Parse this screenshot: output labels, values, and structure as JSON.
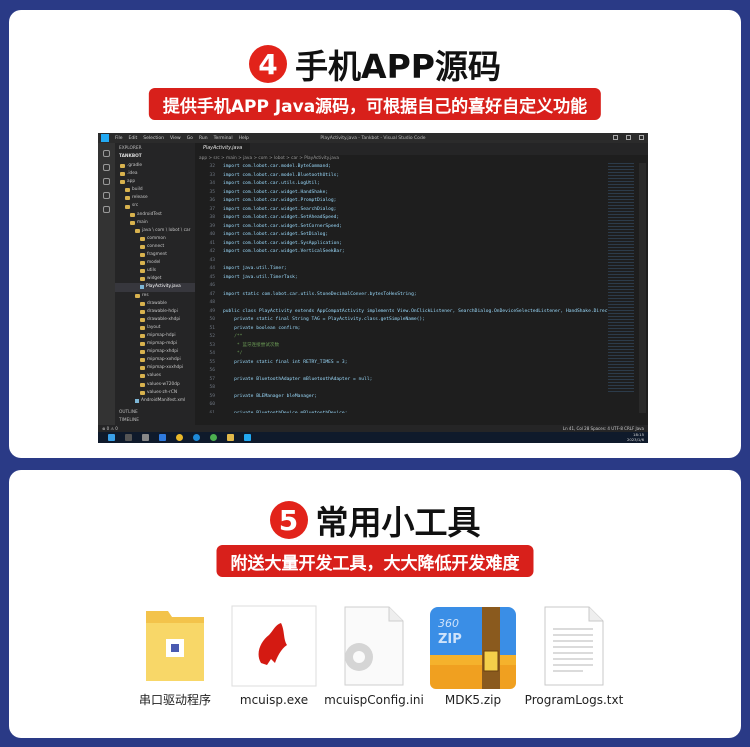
{
  "section4": {
    "number": "4",
    "title": "手机APP源码",
    "subtitle": "提供手机APP Java源码，可根据自己的喜好自定义功能"
  },
  "vscode": {
    "menu": [
      "File",
      "Edit",
      "Selection",
      "View",
      "Go",
      "Run",
      "Terminal",
      "Help"
    ],
    "window_title": "PlayActivity.java - Tankbot - Visual Studio Code",
    "explorer_header": "EXPLORER",
    "explorer_root": "TANKBOT",
    "tree": [
      {
        "label": ".gradle",
        "type": "folder",
        "indent": 1
      },
      {
        "label": ".idea",
        "type": "folder",
        "indent": 1
      },
      {
        "label": "app",
        "type": "folder",
        "indent": 1
      },
      {
        "label": "build",
        "type": "folder",
        "indent": 2
      },
      {
        "label": "release",
        "type": "folder",
        "indent": 2
      },
      {
        "label": "src",
        "type": "folder",
        "indent": 2
      },
      {
        "label": "androidTest",
        "type": "folder",
        "indent": 3
      },
      {
        "label": "main",
        "type": "folder",
        "indent": 3
      },
      {
        "label": "java \\ com \\ lobot \\ car",
        "type": "folder",
        "indent": 4
      },
      {
        "label": "common",
        "type": "folder",
        "indent": 5
      },
      {
        "label": "connect",
        "type": "folder",
        "indent": 5
      },
      {
        "label": "fragment",
        "type": "folder",
        "indent": 5
      },
      {
        "label": "model",
        "type": "folder",
        "indent": 5
      },
      {
        "label": "utils",
        "type": "folder",
        "indent": 5
      },
      {
        "label": "widget",
        "type": "folder",
        "indent": 5
      },
      {
        "label": "PlayActivity.java",
        "type": "file",
        "indent": 5,
        "selected": true
      },
      {
        "label": "res",
        "type": "folder",
        "indent": 4
      },
      {
        "label": "drawable",
        "type": "folder",
        "indent": 5
      },
      {
        "label": "drawable-hdpi",
        "type": "folder",
        "indent": 5
      },
      {
        "label": "drawable-xhdpi",
        "type": "folder",
        "indent": 5
      },
      {
        "label": "layout",
        "type": "folder",
        "indent": 5
      },
      {
        "label": "mipmap-hdpi",
        "type": "folder",
        "indent": 5
      },
      {
        "label": "mipmap-mdpi",
        "type": "folder",
        "indent": 5
      },
      {
        "label": "mipmap-xhdpi",
        "type": "folder",
        "indent": 5
      },
      {
        "label": "mipmap-xxhdpi",
        "type": "folder",
        "indent": 5
      },
      {
        "label": "mipmap-xxxhdpi",
        "type": "folder",
        "indent": 5
      },
      {
        "label": "values",
        "type": "folder",
        "indent": 5
      },
      {
        "label": "values-w720dp",
        "type": "folder",
        "indent": 5
      },
      {
        "label": "values-zh-rCN",
        "type": "folder",
        "indent": 5
      },
      {
        "label": "AndroidManifest.xml",
        "type": "file",
        "indent": 4
      }
    ],
    "outline": "OUTLINE",
    "timeline": "TIMELINE",
    "tab": "PlayActivity.java",
    "breadcrumb": "app > src > main > java > com > lobot > car > PlayActivity.java",
    "code": [
      {
        "n": "32",
        "t": "import com.lobot.car.model.ByteCommand;"
      },
      {
        "n": "33",
        "t": "import com.lobot.car.model.BluetoothUtils;"
      },
      {
        "n": "34",
        "t": "import com.lobot.car.utils.LogUtil;"
      },
      {
        "n": "35",
        "t": "import com.lobot.car.widget.HandShake;"
      },
      {
        "n": "36",
        "t": "import com.lobot.car.widget.PromptDialog;"
      },
      {
        "n": "37",
        "t": "import com.lobot.car.widget.SearchDialog;"
      },
      {
        "n": "38",
        "t": "import com.lobot.car.widget.SetAheadSpeed;"
      },
      {
        "n": "39",
        "t": "import com.lobot.car.widget.SetCornerSpeed;"
      },
      {
        "n": "40",
        "t": "import com.lobot.car.widget.SetDialog;"
      },
      {
        "n": "41",
        "t": "import com.lobot.car.widget.SysApplication;"
      },
      {
        "n": "42",
        "t": "import com.lobot.car.widget.VerticalSeekBar;"
      },
      {
        "n": "43",
        "t": ""
      },
      {
        "n": "44",
        "t": "import java.util.Timer;"
      },
      {
        "n": "45",
        "t": "import java.util.TimerTask;"
      },
      {
        "n": "46",
        "t": ""
      },
      {
        "n": "47",
        "t": "import static com.lobot.car.utils.StoneDecimalConver.bytesToHexString;"
      },
      {
        "n": "48",
        "t": ""
      },
      {
        "n": "49",
        "t": "public class PlayActivity extends AppCompatActivity implements View.OnClickListener, SearchDialog.OnDeviceSelectedListener, HandShake.Directi"
      },
      {
        "n": "50",
        "t": "    private static final String TAG = PlayActivity.class.getSimpleName();"
      },
      {
        "n": "51",
        "t": "    private boolean confirm;"
      },
      {
        "n": "52",
        "t": "    /**"
      },
      {
        "n": "53",
        "t": "     * 蓝牙连接尝试次数"
      },
      {
        "n": "54",
        "t": "     */"
      },
      {
        "n": "55",
        "t": "    private static final int RETRY_TIMES = 3;"
      },
      {
        "n": "56",
        "t": ""
      },
      {
        "n": "57",
        "t": "    private BluetoothAdapter mBluetoothAdapter = null;"
      },
      {
        "n": "58",
        "t": ""
      },
      {
        "n": "59",
        "t": "    private BLEManager bleManager;"
      },
      {
        "n": "60",
        "t": ""
      },
      {
        "n": "61",
        "t": "    private BluetoothDevice mBluetoothDevice;"
      },
      {
        "n": "62",
        "t": ""
      },
      {
        "n": "63",
        "t": "    private Handler mHandler;"
      },
      {
        "n": "64",
        "t": ""
      },
      {
        "n": "65",
        "t": "    private ImageButton btStateBtn; //蓝牙"
      },
      {
        "n": "66",
        "t": ""
      },
      {
        "n": "67",
        "t": "    /**"
      },
      {
        "n": "68",
        "t": "     * 连接次数"
      }
    ],
    "status_left": "⊗ 0 ⚠ 0",
    "status_right": "Ln 41, Col 28   Spaces: 4   UTF-8   CRLF   Java",
    "clock_time": "18:15",
    "clock_date": "2023/1/6"
  },
  "section5": {
    "number": "5",
    "title": "常用小工具",
    "subtitle": "附送大量开发工具，大大降低开发难度"
  },
  "files": [
    {
      "name": "串口驱动程序",
      "icon": "folder-icon"
    },
    {
      "name": "mcuisp.exe",
      "icon": "exe-icon"
    },
    {
      "name": "mcuispConfig.ini",
      "icon": "ini-file-icon"
    },
    {
      "name": "MDK5.zip",
      "icon": "zip-archive-icon"
    },
    {
      "name": "ProgramLogs.txt",
      "icon": "text-file-icon"
    }
  ],
  "colors": {
    "accent_red": "#e2231a",
    "banner_red": "#d8201b",
    "page_blue": "#2a3a86"
  }
}
